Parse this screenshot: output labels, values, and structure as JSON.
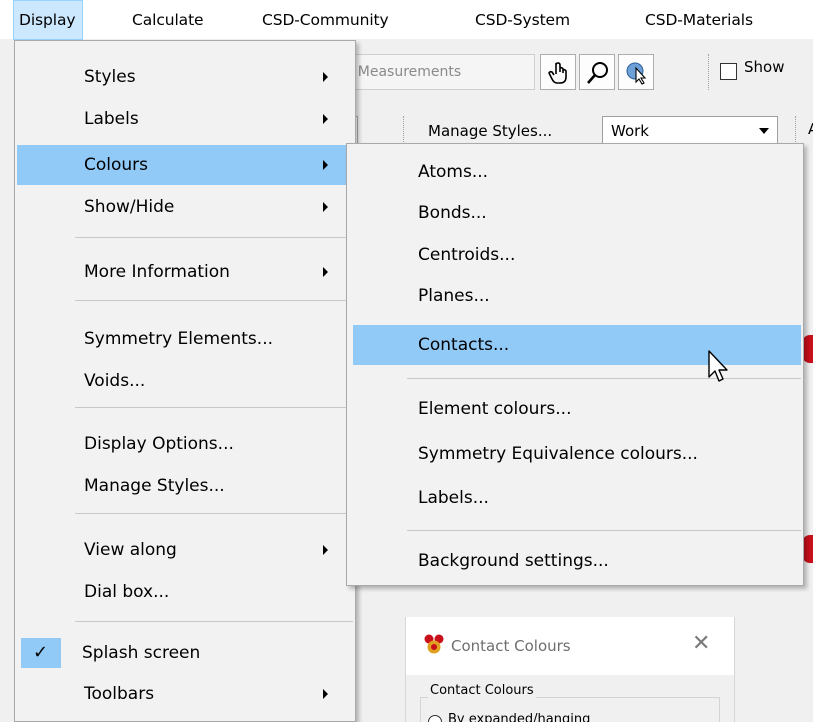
{
  "menubar": {
    "items": [
      {
        "label": "Display",
        "active": true
      },
      {
        "label": "Calculate"
      },
      {
        "label": "CSD-Community"
      },
      {
        "label": "CSD-System"
      },
      {
        "label": "CSD-Materials"
      }
    ]
  },
  "toolbar": {
    "measurements_label": "ar Measurements",
    "show_label": "Show",
    "manage_styles_label": "Manage Styles...",
    "style_combo_value": "Work",
    "edge_letter": "A",
    "icons": [
      "hand-pointer-icon",
      "magnifier-icon",
      "select-arrow-icon"
    ]
  },
  "display_menu": {
    "items": [
      {
        "label": "Styles",
        "submenu": true
      },
      {
        "label": "Labels",
        "submenu": true
      },
      {
        "label": "Colours",
        "submenu": true,
        "highlighted": true
      },
      {
        "label": "Show/Hide",
        "submenu": true
      },
      {
        "label": "More Information",
        "submenu": true
      },
      {
        "label": "Symmetry Elements..."
      },
      {
        "label": "Voids..."
      },
      {
        "label": "Display Options..."
      },
      {
        "label": "Manage Styles..."
      },
      {
        "label": "View along",
        "submenu": true
      },
      {
        "label": "Dial box..."
      },
      {
        "label": "Splash screen",
        "checked": true
      },
      {
        "label": "Toolbars",
        "submenu": true
      }
    ]
  },
  "colours_submenu": {
    "items": [
      {
        "label": "Atoms..."
      },
      {
        "label": "Bonds..."
      },
      {
        "label": "Centroids..."
      },
      {
        "label": "Planes..."
      },
      {
        "label": "Contacts...",
        "highlighted": true
      },
      {
        "label": "Element colours..."
      },
      {
        "label": "Symmetry Equivalence colours..."
      },
      {
        "label": "Labels..."
      },
      {
        "label": "Background settings..."
      }
    ]
  },
  "dialog": {
    "title": "Contact Colours",
    "close_symbol": "✕",
    "group_label": "Contact Colours",
    "radio_label": "By expanded/hanging"
  },
  "colors": {
    "menu_highlight": "#91c9f7",
    "menubar_active": "#cce8ff",
    "accent_red": "#c8101a"
  }
}
